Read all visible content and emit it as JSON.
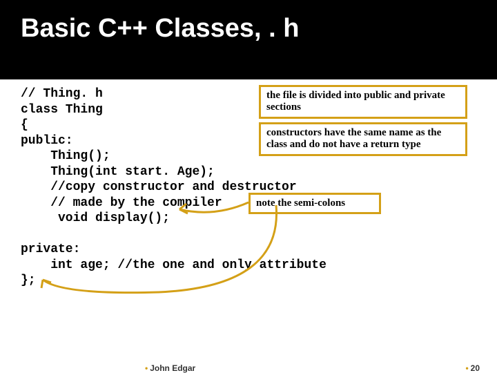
{
  "title": "Basic C++ Classes, . h",
  "code": "// Thing. h\nclass Thing\n{\npublic:\n    Thing();\n    Thing(int start. Age);\n    //copy constructor and destructor\n    // made by the compiler\n     void display();\n\nprivate:\n    int age; //the one and only attribute\n};",
  "callouts": {
    "c1": "the file is divided into public and private sections",
    "c2": "constructors have the same name as the class and do not have a return type",
    "c3": "note the semi-colons"
  },
  "footer": {
    "author": "John Edgar",
    "page": "20"
  }
}
